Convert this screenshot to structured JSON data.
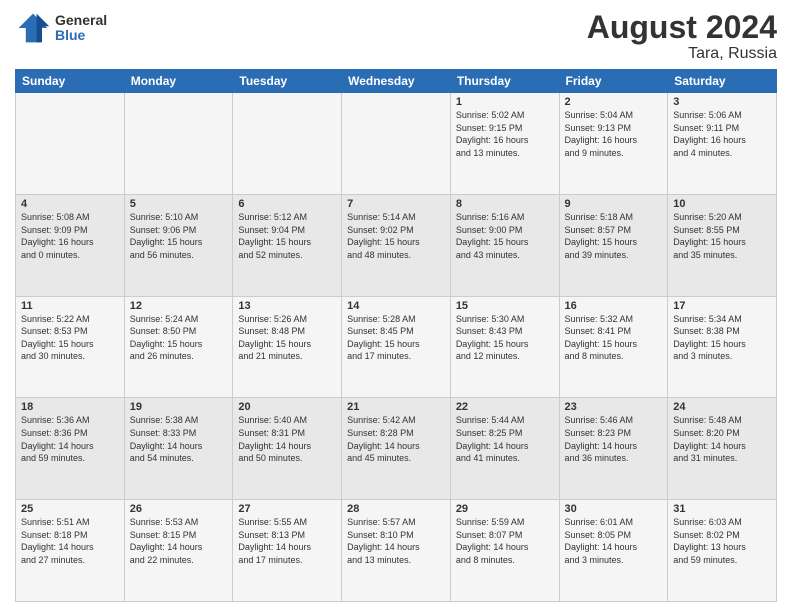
{
  "logo": {
    "general": "General",
    "blue": "Blue"
  },
  "title": "August 2024",
  "location": "Tara, Russia",
  "days_of_week": [
    "Sunday",
    "Monday",
    "Tuesday",
    "Wednesday",
    "Thursday",
    "Friday",
    "Saturday"
  ],
  "weeks": [
    [
      {
        "day": "",
        "info": ""
      },
      {
        "day": "",
        "info": ""
      },
      {
        "day": "",
        "info": ""
      },
      {
        "day": "",
        "info": ""
      },
      {
        "day": "1",
        "info": "Sunrise: 5:02 AM\nSunset: 9:15 PM\nDaylight: 16 hours\nand 13 minutes."
      },
      {
        "day": "2",
        "info": "Sunrise: 5:04 AM\nSunset: 9:13 PM\nDaylight: 16 hours\nand 9 minutes."
      },
      {
        "day": "3",
        "info": "Sunrise: 5:06 AM\nSunset: 9:11 PM\nDaylight: 16 hours\nand 4 minutes."
      }
    ],
    [
      {
        "day": "4",
        "info": "Sunrise: 5:08 AM\nSunset: 9:09 PM\nDaylight: 16 hours\nand 0 minutes."
      },
      {
        "day": "5",
        "info": "Sunrise: 5:10 AM\nSunset: 9:06 PM\nDaylight: 15 hours\nand 56 minutes."
      },
      {
        "day": "6",
        "info": "Sunrise: 5:12 AM\nSunset: 9:04 PM\nDaylight: 15 hours\nand 52 minutes."
      },
      {
        "day": "7",
        "info": "Sunrise: 5:14 AM\nSunset: 9:02 PM\nDaylight: 15 hours\nand 48 minutes."
      },
      {
        "day": "8",
        "info": "Sunrise: 5:16 AM\nSunset: 9:00 PM\nDaylight: 15 hours\nand 43 minutes."
      },
      {
        "day": "9",
        "info": "Sunrise: 5:18 AM\nSunset: 8:57 PM\nDaylight: 15 hours\nand 39 minutes."
      },
      {
        "day": "10",
        "info": "Sunrise: 5:20 AM\nSunset: 8:55 PM\nDaylight: 15 hours\nand 35 minutes."
      }
    ],
    [
      {
        "day": "11",
        "info": "Sunrise: 5:22 AM\nSunset: 8:53 PM\nDaylight: 15 hours\nand 30 minutes."
      },
      {
        "day": "12",
        "info": "Sunrise: 5:24 AM\nSunset: 8:50 PM\nDaylight: 15 hours\nand 26 minutes."
      },
      {
        "day": "13",
        "info": "Sunrise: 5:26 AM\nSunset: 8:48 PM\nDaylight: 15 hours\nand 21 minutes."
      },
      {
        "day": "14",
        "info": "Sunrise: 5:28 AM\nSunset: 8:45 PM\nDaylight: 15 hours\nand 17 minutes."
      },
      {
        "day": "15",
        "info": "Sunrise: 5:30 AM\nSunset: 8:43 PM\nDaylight: 15 hours\nand 12 minutes."
      },
      {
        "day": "16",
        "info": "Sunrise: 5:32 AM\nSunset: 8:41 PM\nDaylight: 15 hours\nand 8 minutes."
      },
      {
        "day": "17",
        "info": "Sunrise: 5:34 AM\nSunset: 8:38 PM\nDaylight: 15 hours\nand 3 minutes."
      }
    ],
    [
      {
        "day": "18",
        "info": "Sunrise: 5:36 AM\nSunset: 8:36 PM\nDaylight: 14 hours\nand 59 minutes."
      },
      {
        "day": "19",
        "info": "Sunrise: 5:38 AM\nSunset: 8:33 PM\nDaylight: 14 hours\nand 54 minutes."
      },
      {
        "day": "20",
        "info": "Sunrise: 5:40 AM\nSunset: 8:31 PM\nDaylight: 14 hours\nand 50 minutes."
      },
      {
        "day": "21",
        "info": "Sunrise: 5:42 AM\nSunset: 8:28 PM\nDaylight: 14 hours\nand 45 minutes."
      },
      {
        "day": "22",
        "info": "Sunrise: 5:44 AM\nSunset: 8:25 PM\nDaylight: 14 hours\nand 41 minutes."
      },
      {
        "day": "23",
        "info": "Sunrise: 5:46 AM\nSunset: 8:23 PM\nDaylight: 14 hours\nand 36 minutes."
      },
      {
        "day": "24",
        "info": "Sunrise: 5:48 AM\nSunset: 8:20 PM\nDaylight: 14 hours\nand 31 minutes."
      }
    ],
    [
      {
        "day": "25",
        "info": "Sunrise: 5:51 AM\nSunset: 8:18 PM\nDaylight: 14 hours\nand 27 minutes."
      },
      {
        "day": "26",
        "info": "Sunrise: 5:53 AM\nSunset: 8:15 PM\nDaylight: 14 hours\nand 22 minutes."
      },
      {
        "day": "27",
        "info": "Sunrise: 5:55 AM\nSunset: 8:13 PM\nDaylight: 14 hours\nand 17 minutes."
      },
      {
        "day": "28",
        "info": "Sunrise: 5:57 AM\nSunset: 8:10 PM\nDaylight: 14 hours\nand 13 minutes."
      },
      {
        "day": "29",
        "info": "Sunrise: 5:59 AM\nSunset: 8:07 PM\nDaylight: 14 hours\nand 8 minutes."
      },
      {
        "day": "30",
        "info": "Sunrise: 6:01 AM\nSunset: 8:05 PM\nDaylight: 14 hours\nand 3 minutes."
      },
      {
        "day": "31",
        "info": "Sunrise: 6:03 AM\nSunset: 8:02 PM\nDaylight: 13 hours\nand 59 minutes."
      }
    ]
  ]
}
